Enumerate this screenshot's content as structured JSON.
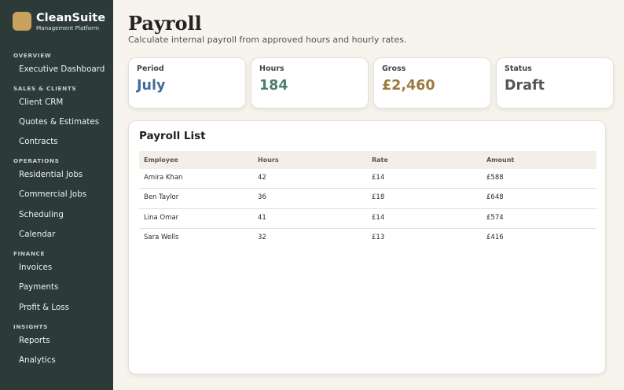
{
  "brand": {
    "name": "CleanSuite",
    "subtitle": "Management Platform"
  },
  "sidebar": {
    "sections": [
      {
        "title": "OVERVIEW",
        "items": [
          "Executive Dashboard"
        ]
      },
      {
        "title": "SALES & CLIENTS",
        "items": [
          "Client CRM",
          "Quotes & Estimates",
          "Contracts"
        ]
      },
      {
        "title": "OPERATIONS",
        "items": [
          "Residential Jobs",
          "Commercial Jobs",
          "Scheduling",
          "Calendar"
        ]
      },
      {
        "title": "FINANCE",
        "items": [
          "Invoices",
          "Payments",
          "Profit & Loss"
        ]
      },
      {
        "title": "INSIGHTS",
        "items": [
          "Reports",
          "Analytics"
        ]
      }
    ]
  },
  "page": {
    "title": "Payroll",
    "subtitle": "Calculate internal payroll from approved hours and hourly rates."
  },
  "stats": [
    {
      "label": "Period",
      "value": "July",
      "color": "#3f6d98"
    },
    {
      "label": "Hours",
      "value": "184",
      "color": "#4e7f6a"
    },
    {
      "label": "Gross",
      "value": "£2,460",
      "color": "#9a7a3e"
    },
    {
      "label": "Status",
      "value": "Draft",
      "color": "#555555"
    }
  ],
  "payroll": {
    "title": "Payroll List",
    "columns": [
      "Employee",
      "Hours",
      "Rate",
      "Amount"
    ],
    "rows": [
      [
        "Amira Khan",
        "42",
        "£14",
        "£588"
      ],
      [
        "Ben Taylor",
        "36",
        "£18",
        "£648"
      ],
      [
        "Lina Omar",
        "41",
        "£14",
        "£574"
      ],
      [
        "Sara Wells",
        "32",
        "£13",
        "£416"
      ]
    ]
  }
}
